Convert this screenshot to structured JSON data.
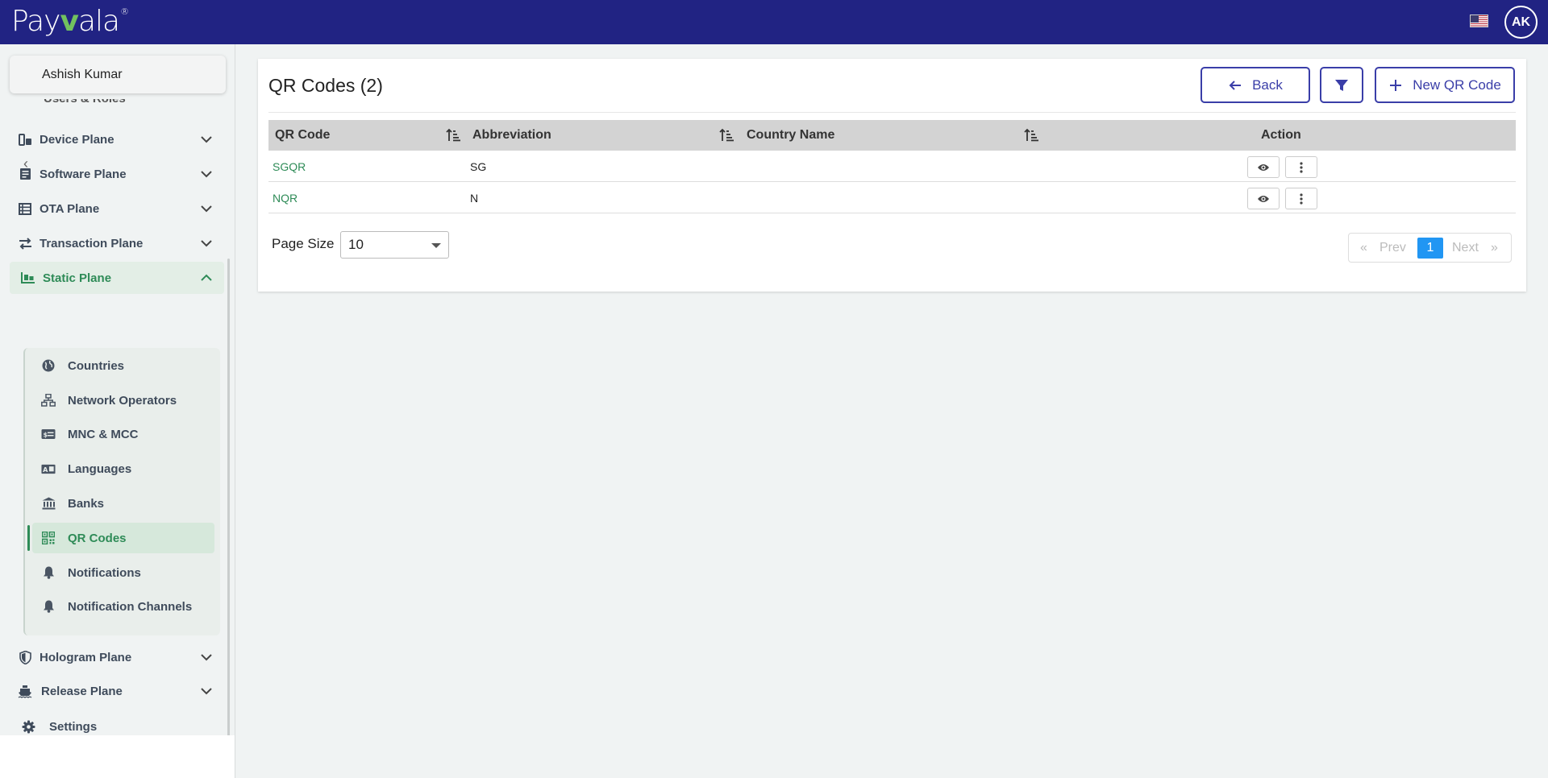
{
  "app": {
    "logo_text_pre": "Pay",
    "logo_text_v": "v",
    "logo_text_post": "ala",
    "logo_reg": "®"
  },
  "header": {
    "avatar_initials": "AK"
  },
  "sidebar": {
    "user_name": "Ashish Kumar",
    "partial_item": "Users & Roles",
    "items": [
      {
        "label": "Device Plane"
      },
      {
        "label": "Software Plane"
      },
      {
        "label": "OTA Plane"
      },
      {
        "label": "Transaction Plane"
      },
      {
        "label": "Static Plane"
      },
      {
        "label": "Hologram Plane"
      },
      {
        "label": "Release Plane"
      },
      {
        "label": "Settings"
      }
    ],
    "sub_items": [
      {
        "label": "Countries"
      },
      {
        "label": "Network Operators"
      },
      {
        "label": "MNC & MCC"
      },
      {
        "label": "Languages"
      },
      {
        "label": "Banks"
      },
      {
        "label": "QR Codes"
      },
      {
        "label": "Notifications"
      },
      {
        "label": "Notification Channels"
      }
    ]
  },
  "main": {
    "title": "QR Codes (2)",
    "back_label": "Back",
    "new_label": "New QR Code",
    "columns": [
      "QR Code",
      "Abbreviation",
      "Country Name",
      "Action"
    ],
    "rows": [
      {
        "qr_code": "SGQR",
        "abbreviation": "SG",
        "country": ""
      },
      {
        "qr_code": "NQR",
        "abbreviation": "N",
        "country": ""
      }
    ],
    "page_size_label": "Page Size",
    "page_size_value": "10",
    "pagination": {
      "first": "«",
      "prev": "Prev",
      "current": "1",
      "next": "Next",
      "last": "»"
    }
  },
  "colors": {
    "topbar": "#212383",
    "accent_green": "#2e8b57",
    "primary_blue": "#3a3ea8",
    "page_active": "#2196f3"
  }
}
